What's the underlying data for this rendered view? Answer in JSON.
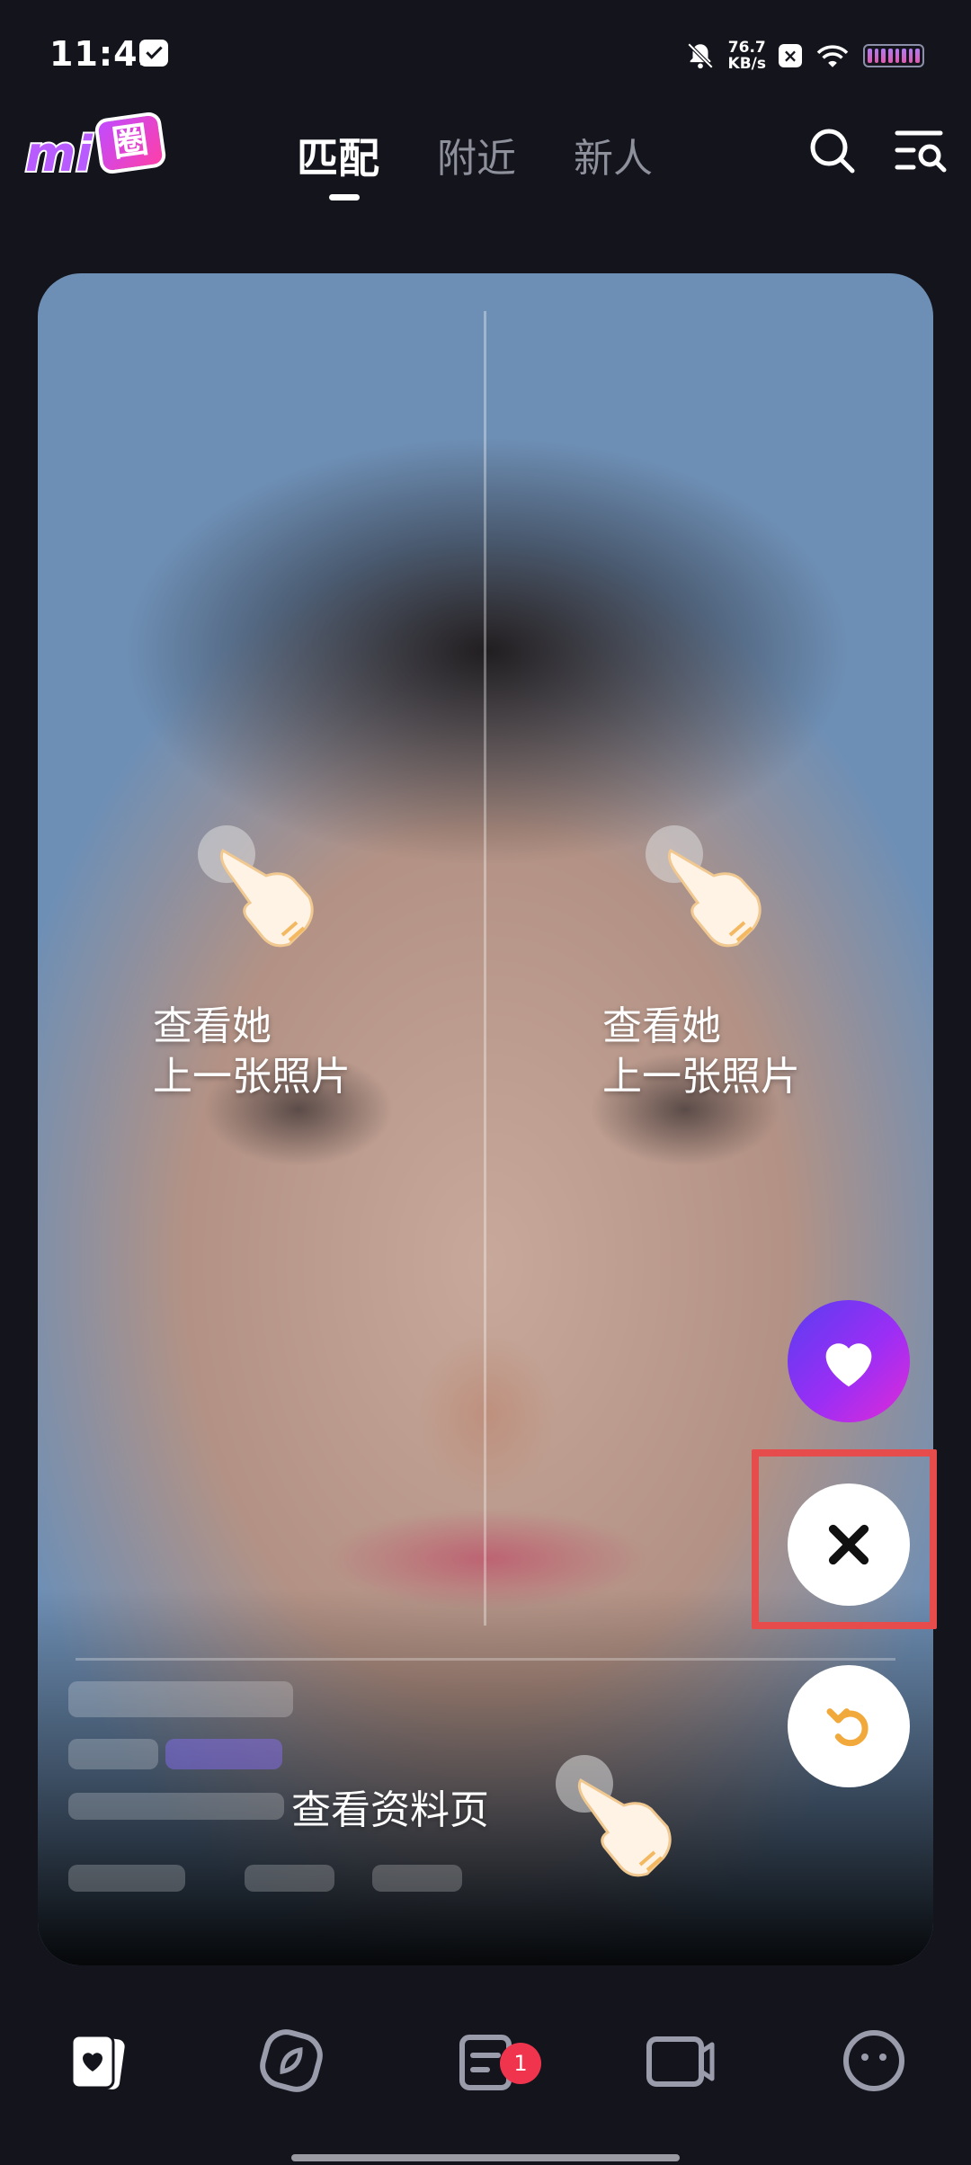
{
  "status_bar": {
    "time": "11:43",
    "net_speed_value": "76.7",
    "net_speed_unit": "KB/s",
    "icons": [
      "message-icon",
      "bell-muted-icon",
      "x-app-icon",
      "wifi-icon",
      "battery-icon"
    ]
  },
  "header": {
    "logo_mi": "mi",
    "logo_quan": "圈",
    "tabs": [
      {
        "label": "匹配",
        "active": true
      },
      {
        "label": "附近",
        "active": false
      },
      {
        "label": "新人",
        "active": false
      }
    ]
  },
  "card": {
    "hint_left": {
      "line1": "查看她",
      "line2": "上一张照片"
    },
    "hint_right": {
      "line1": "查看她",
      "line2": "上一张照片"
    },
    "hint_profile": "查看资料页"
  },
  "actions": {
    "like_color": "#9b2ef5",
    "dislike_icon": "close-icon",
    "undo_icon": "undo-icon",
    "highlight_color": "#e74c4c"
  },
  "bottom_nav": {
    "items": [
      "cards-icon",
      "explore-icon",
      "messages-icon",
      "video-icon",
      "profile-icon"
    ],
    "messages_badge": "1"
  }
}
